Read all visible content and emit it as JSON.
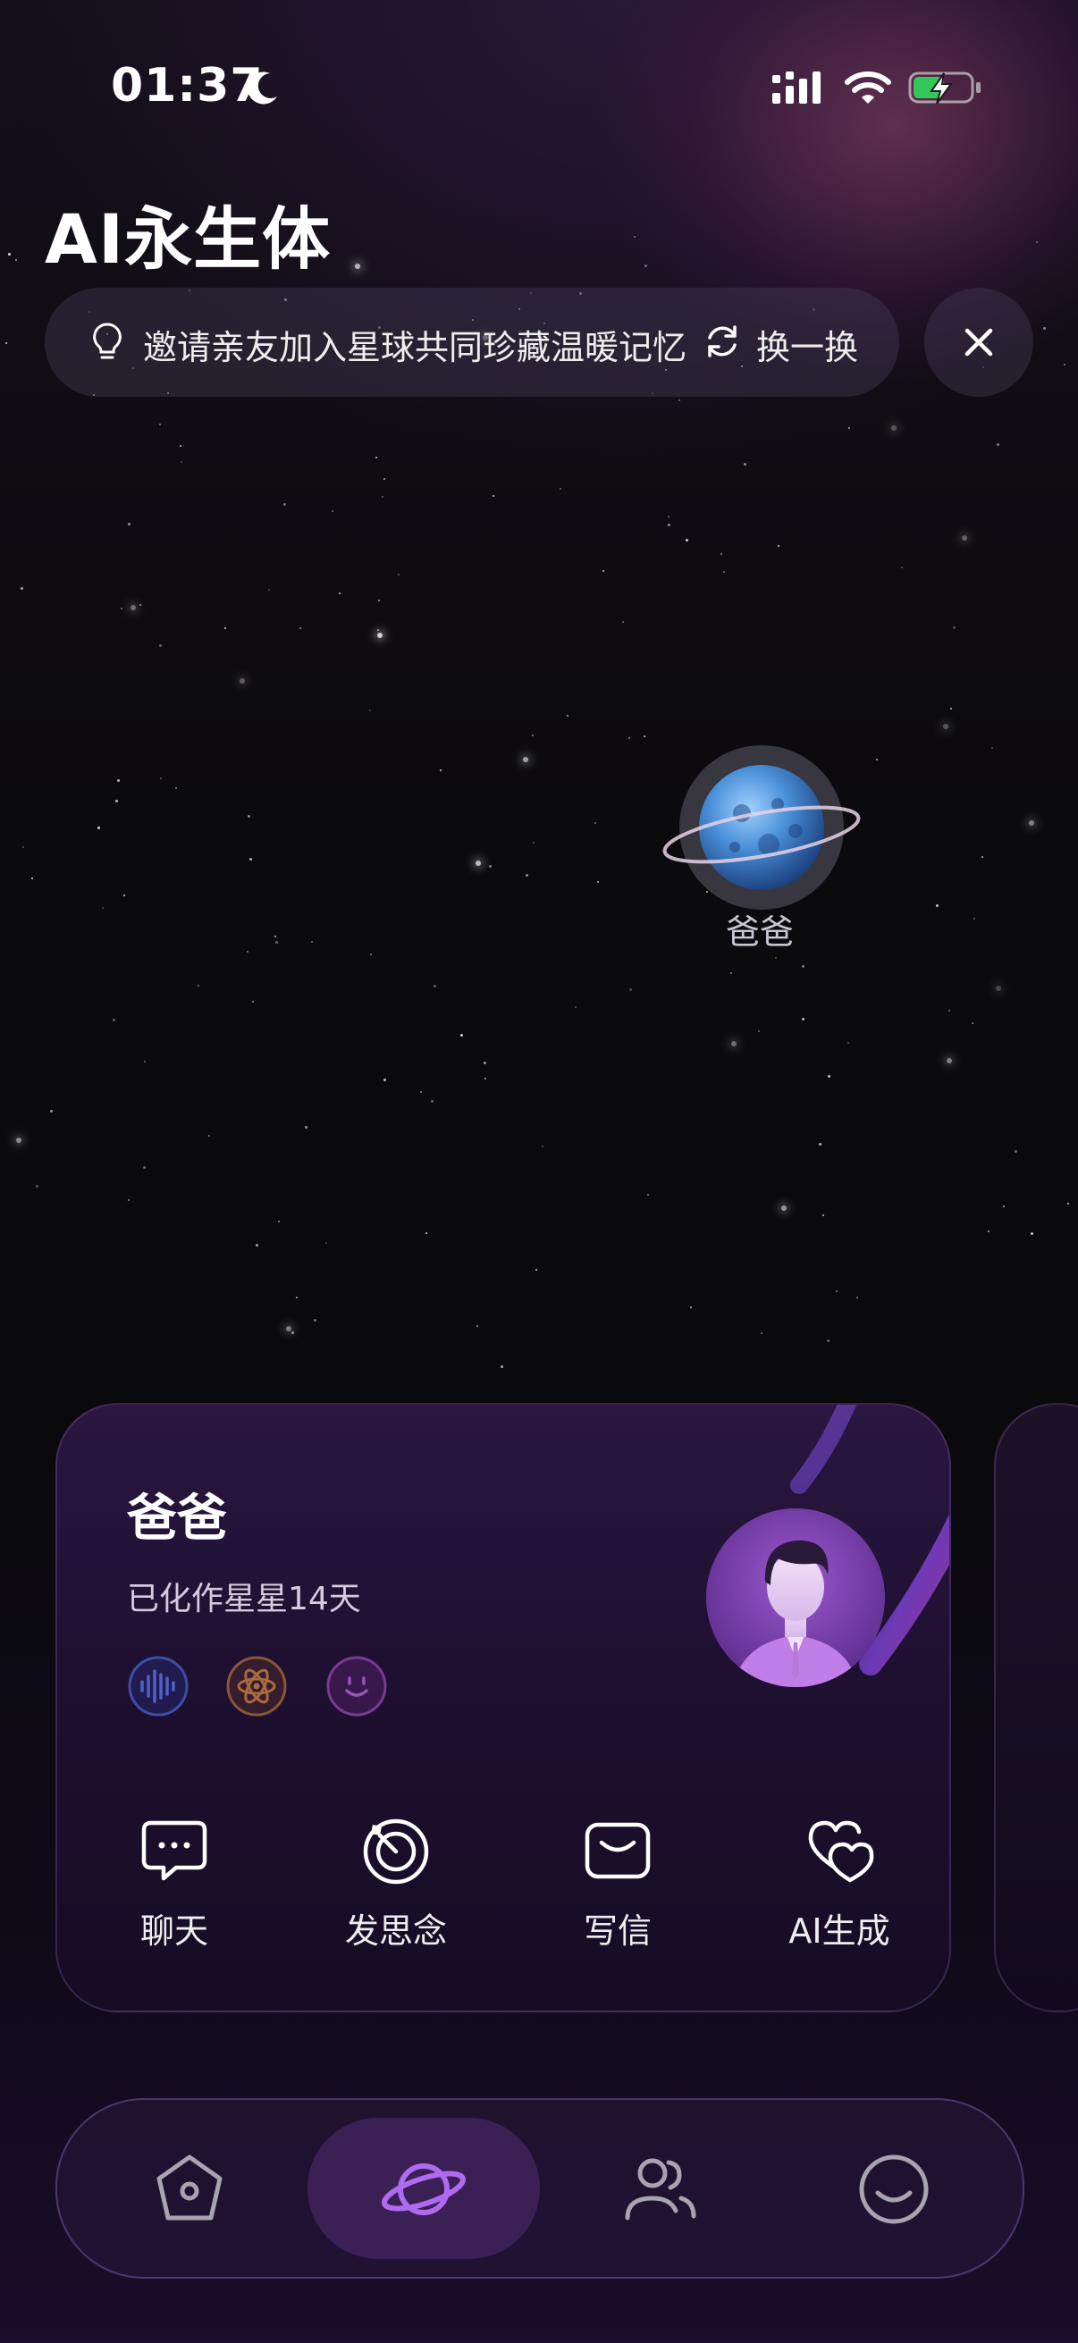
{
  "status_bar": {
    "time": "01:37",
    "icons": [
      "moon-icon",
      "signal-icon",
      "wifi-icon",
      "battery-charging-icon"
    ]
  },
  "header": {
    "title": "AI永生体"
  },
  "tip_bar": {
    "text": "邀请亲友加入星球共同珍藏温暖记忆",
    "refresh_label": "换一换",
    "icons": [
      "lightbulb-icon",
      "refresh-icon",
      "close-icon"
    ]
  },
  "planet": {
    "label": "爸爸",
    "icon": "planet-icon"
  },
  "card": {
    "name": "爸爸",
    "subtitle": "已化作星星14天",
    "traits": [
      "voice-wave-icon",
      "atom-icon",
      "smile-face-icon"
    ],
    "actions": [
      {
        "label": "聊天",
        "icon": "chat-bubble-icon"
      },
      {
        "label": "发思念",
        "icon": "target-send-icon"
      },
      {
        "label": "写信",
        "icon": "mail-icon"
      },
      {
        "label": "AI生成",
        "icon": "double-heart-icon"
      }
    ]
  },
  "bottom_nav": {
    "items": [
      {
        "name": "home",
        "icon": "home-icon",
        "active": false
      },
      {
        "name": "planet",
        "icon": "planet-icon",
        "active": true
      },
      {
        "name": "friends",
        "icon": "people-icon",
        "active": false
      },
      {
        "name": "profile",
        "icon": "smile-icon",
        "active": false
      }
    ]
  },
  "colors": {
    "accent": "#b06af0",
    "background": "#0a0a0c",
    "card": "#1e1030"
  }
}
